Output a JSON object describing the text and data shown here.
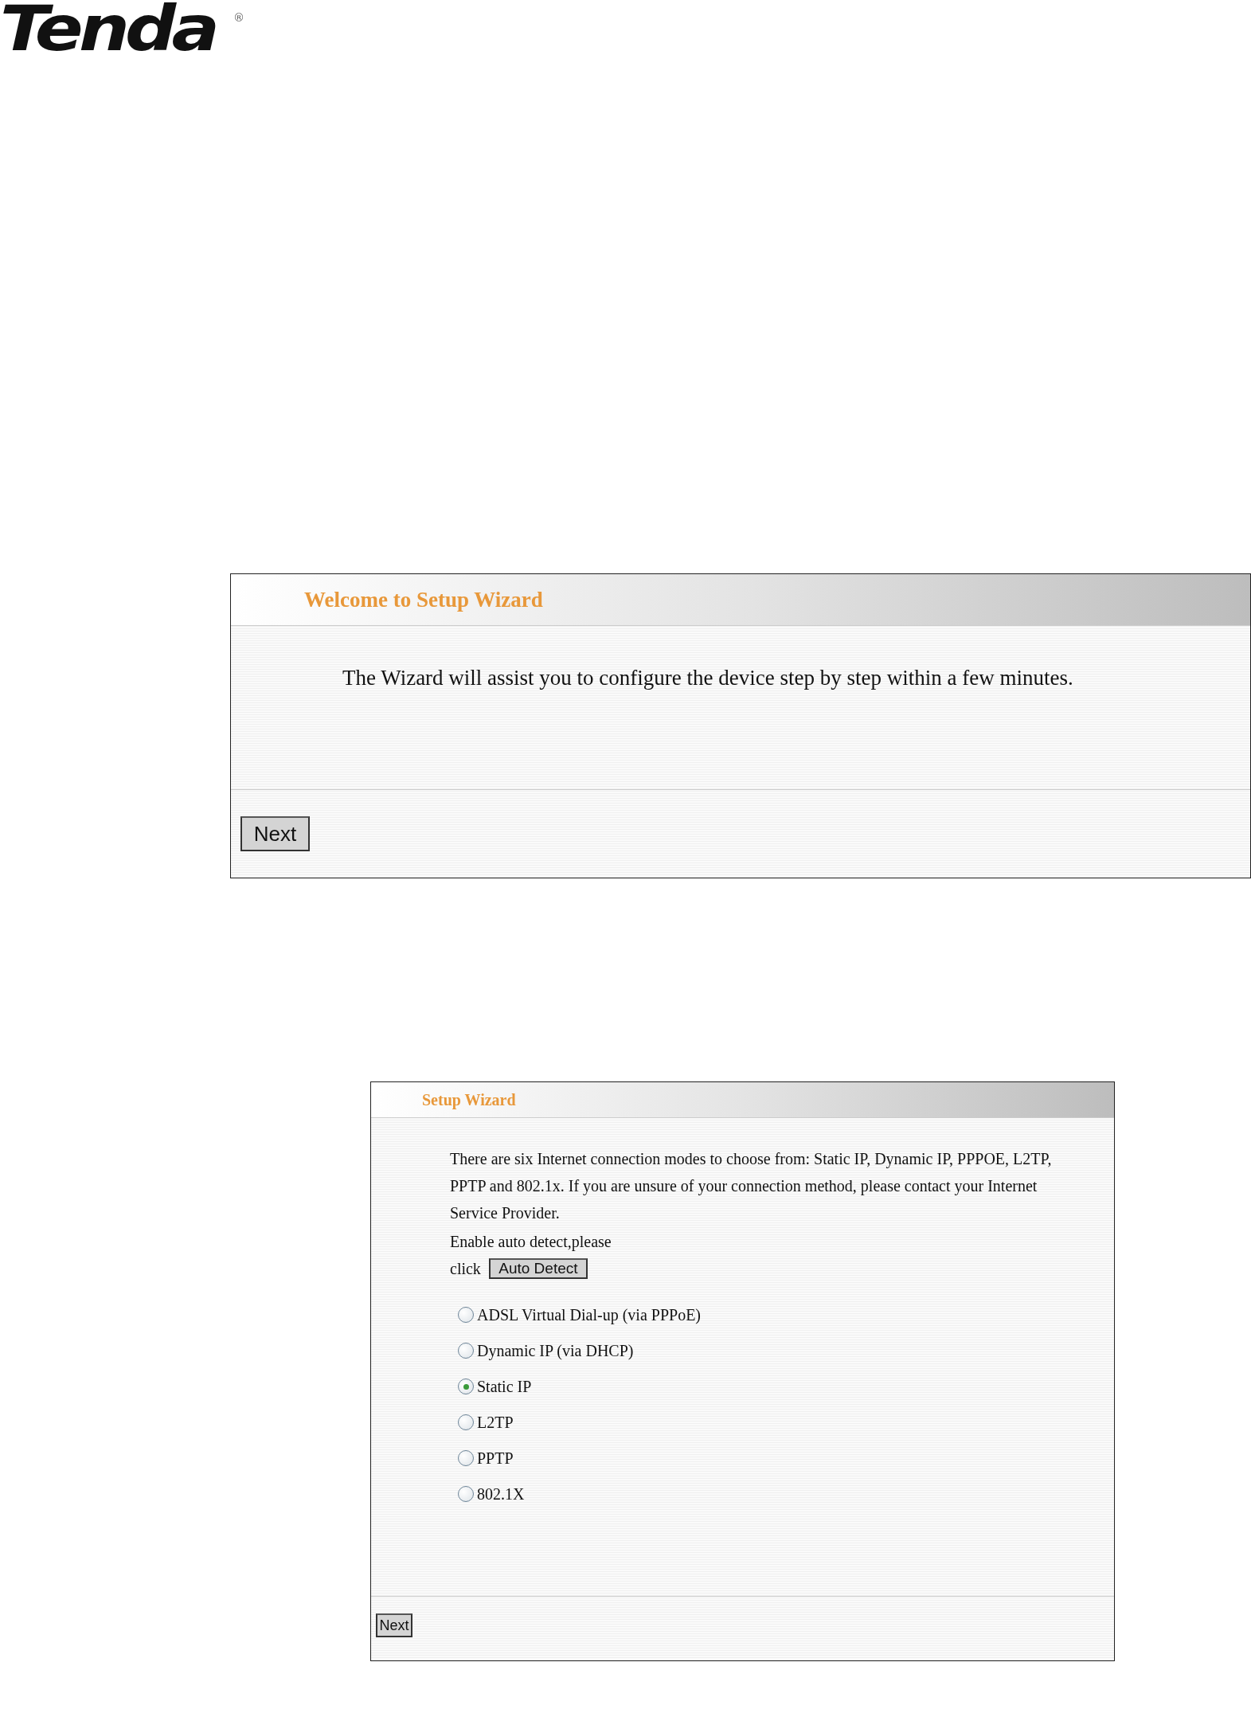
{
  "logo": {
    "name": "Tenda",
    "mark": "®"
  },
  "welcome_panel": {
    "title": "Welcome to Setup Wizard",
    "text": "The Wizard will assist you to configure the device step by step within a few minutes.",
    "button": "Next"
  },
  "wizard_panel": {
    "title": "Setup Wizard",
    "text": "There are six Internet connection modes to choose from: Static IP, Dynamic IP, PPPOE, L2TP, PPTP and 802.1x. If you are unsure of your connection method, please contact your Internet Service Provider.",
    "auto_detect_prompt": "Enable auto detect,please",
    "click_label": "click",
    "auto_detect_button": "Auto Detect",
    "modes": [
      {
        "label": "ADSL Virtual Dial-up (via PPPoE)",
        "selected": false
      },
      {
        "label": "Dynamic IP (via DHCP)",
        "selected": false
      },
      {
        "label": "Static IP",
        "selected": true
      },
      {
        "label": "L2TP",
        "selected": false
      },
      {
        "label": "PPTP",
        "selected": false
      },
      {
        "label": "802.1X",
        "selected": false
      }
    ],
    "button": "Next"
  }
}
